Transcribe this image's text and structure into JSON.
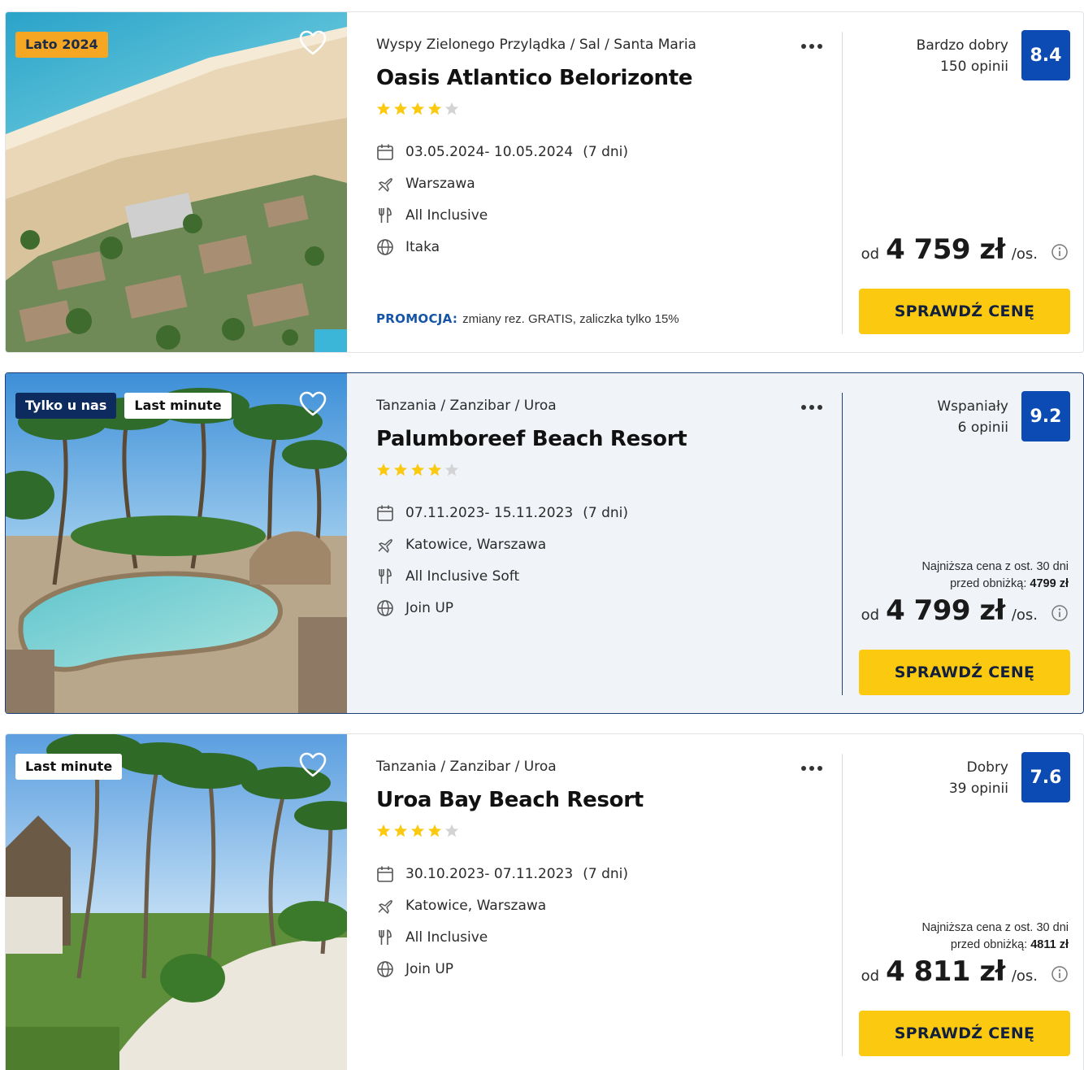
{
  "offers": [
    {
      "badges": [
        {
          "label": "Lato 2024",
          "style": "orange"
        }
      ],
      "breadcrumb": "Wyspy Zielonego Przylądka / Sal / Santa Maria",
      "name": "Oasis Atlantico Belorizonte",
      "stars": 4,
      "dates": "03.05.2024- 10.05.2024",
      "duration": "(7 dni)",
      "departure": "Warszawa",
      "board": "All Inclusive",
      "operator": "Itaka",
      "promo_label": "PROMOCJA:",
      "promo_text": "zmiany rez. GRATIS, zaliczka tylko 15%",
      "rating_label": "Bardzo dobry",
      "reviews": "150 opinii",
      "score": "8.4",
      "lowest_price_line1": "",
      "lowest_price_line2": "",
      "lowest_price_value": "",
      "price_prefix": "od",
      "price": "4 759 zł",
      "price_suffix": "/os.",
      "cta": "SPRAWDŹ CENĘ",
      "highlight": false,
      "photo": "beach-resort-aerial"
    },
    {
      "badges": [
        {
          "label": "Tylko u nas",
          "style": "navy"
        },
        {
          "label": "Last minute",
          "style": "white"
        }
      ],
      "breadcrumb": "Tanzania / Zanzibar / Uroa",
      "name": "Palumboreef Beach Resort",
      "stars": 4,
      "dates": "07.11.2023- 15.11.2023",
      "duration": "(7 dni)",
      "departure": "Katowice, Warszawa",
      "board": "All Inclusive Soft",
      "operator": "Join UP",
      "promo_label": "",
      "promo_text": "",
      "rating_label": "Wspaniały",
      "reviews": "6 opinii",
      "score": "9.2",
      "lowest_price_line1": "Najniższa cena z ost. 30 dni",
      "lowest_price_line2": "przed obniżką:",
      "lowest_price_value": "4799 zł",
      "price_prefix": "od",
      "price": "4 799 zł",
      "price_suffix": "/os.",
      "cta": "SPRAWDŹ CENĘ",
      "highlight": true,
      "photo": "pool-with-palms"
    },
    {
      "badges": [
        {
          "label": "Last minute",
          "style": "white"
        }
      ],
      "breadcrumb": "Tanzania / Zanzibar / Uroa",
      "name": "Uroa Bay Beach Resort",
      "stars": 4,
      "dates": "30.10.2023- 07.11.2023",
      "duration": "(7 dni)",
      "departure": "Katowice, Warszawa",
      "board": "All Inclusive",
      "operator": "Join UP",
      "promo_label": "",
      "promo_text": "",
      "rating_label": "Dobry",
      "reviews": "39 opinii",
      "score": "7.6",
      "lowest_price_line1": "Najniższa cena z ost. 30 dni",
      "lowest_price_line2": "przed obniżką:",
      "lowest_price_value": "4811 zł",
      "price_prefix": "od",
      "price": "4 811 zł",
      "price_suffix": "/os.",
      "cta": "SPRAWDŹ CENĘ",
      "highlight": false,
      "photo": "palm-garden-path"
    }
  ],
  "colors": {
    "accent_button": "#fbc90f",
    "score_badge": "#0b4bb3",
    "promo_label": "#1554a6",
    "star_filled": "#fbc90f",
    "star_empty": "#d3d3d3"
  },
  "icons": {
    "dates": "calendar-icon",
    "departure": "plane-icon",
    "board": "utensils-icon",
    "operator": "globe-icon",
    "favorite": "heart-icon",
    "more": "more-dots-icon",
    "price_info": "info-icon"
  }
}
